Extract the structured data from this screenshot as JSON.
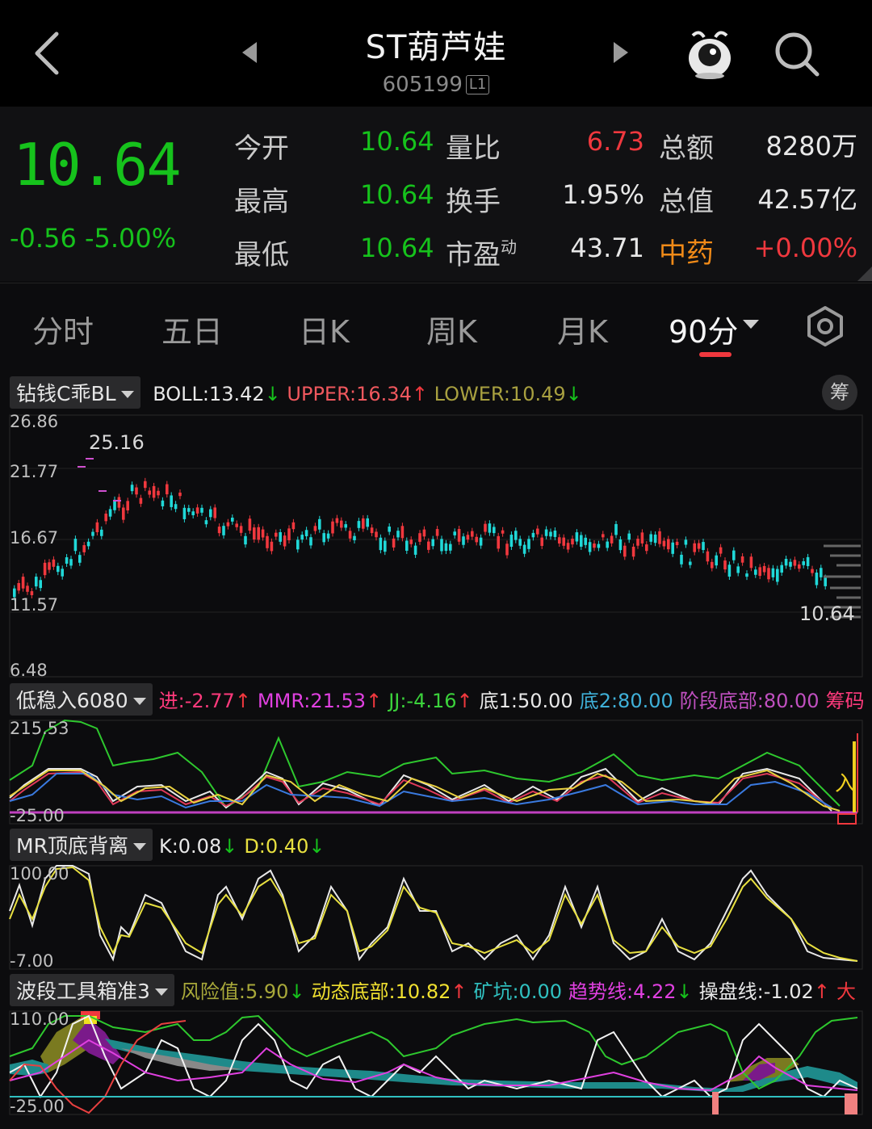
{
  "header": {
    "title": "ST葫芦娃",
    "code": "605199",
    "level_tag": "L1"
  },
  "quote": {
    "price": "10.64",
    "change": "-0.56",
    "change_pct": "-5.00%",
    "rows": [
      {
        "l1": "今开",
        "v1": "10.64",
        "l2": "量比",
        "v2": "6.73",
        "l3": "总额",
        "v3": "8280万"
      },
      {
        "l1": "最高",
        "v1": "10.64",
        "l2": "换手",
        "v2": "1.95%",
        "l3": "总值",
        "v3": "42.57亿"
      },
      {
        "l1": "最低",
        "v1": "10.64",
        "l2": "市盈",
        "l2_sup": "动",
        "v2": "43.71",
        "l3": "中药",
        "v3": "+0.00%"
      }
    ]
  },
  "tabs": [
    "分时",
    "五日",
    "日K",
    "周K",
    "月K",
    "90分"
  ],
  "main_chart": {
    "indicator": "钻钱C乖BL",
    "boll_label": "BOLL:",
    "boll": "13.42",
    "upper_label": "UPPER:",
    "upper": "16.34",
    "lower_label": "LOWER:",
    "lower": "10.49",
    "chou_label": "筹",
    "y_ticks": [
      "26.86",
      "21.77",
      "16.67",
      "11.57",
      "6.48"
    ],
    "ylim": [
      6.48,
      26.86
    ],
    "high_mark": "25.16",
    "last_mark": "10.64"
  },
  "ind1": {
    "name": "低稳入6080",
    "chips": [
      {
        "t": "进:",
        "v": "-2.77",
        "c": "#ff3a7c",
        "arrow": "up"
      },
      {
        "t": "MMR:",
        "v": "21.53",
        "c": "#e040e0",
        "arrow": "up"
      },
      {
        "t": "JJ:",
        "v": "-4.16",
        "c": "#3bd23b",
        "arrow": "up"
      },
      {
        "t": "底1:",
        "v": "50.00",
        "c": "#e8e8e8",
        "arrow": ""
      },
      {
        "t": "底2:",
        "v": "80.00",
        "c": "#3fb0d8",
        "arrow": ""
      },
      {
        "t": "阶段底部:",
        "v": "80.00",
        "c": "#c050c0",
        "arrow": ""
      }
    ],
    "tail": "筹码",
    "y_top": "215.53",
    "y_bottom": "-25.00",
    "entry_mark": "入"
  },
  "ind2": {
    "name": "MR顶底背离",
    "chips": [
      {
        "t": "K:",
        "v": "0.08",
        "c": "#e8e8e8",
        "arrow": "down"
      },
      {
        "t": "D:",
        "v": "0.40",
        "c": "#e8e040",
        "arrow": "down"
      }
    ],
    "y_top": "100.00",
    "y_bottom": "-7.00"
  },
  "ind3": {
    "name": "波段工具箱准3",
    "chips": [
      {
        "t": "风险值:",
        "v": "5.90",
        "c": "#a8a83a",
        "arrow": "down"
      },
      {
        "t": "动态底部:",
        "v": "10.82",
        "c": "#f0e030",
        "arrow": "up"
      },
      {
        "t": "矿坑:",
        "v": "0.00",
        "c": "#30c0c0",
        "arrow": ""
      },
      {
        "t": "趋势线:",
        "v": "4.22",
        "c": "#e040e0",
        "arrow": "down"
      },
      {
        "t": "操盘线:",
        "v": "-1.02",
        "c": "#e8e8e8",
        "arrow": "up"
      }
    ],
    "tail": "大",
    "y_top": "110.00",
    "y_bottom": "-25.00"
  },
  "colors": {
    "up": "#f0383e",
    "down": "#16c21c",
    "accent": "#f0383e"
  },
  "icons": [
    "back-arrow-icon",
    "prev-stock-icon",
    "next-stock-icon",
    "mascot-icon",
    "search-icon",
    "settings-hexagon-icon"
  ]
}
